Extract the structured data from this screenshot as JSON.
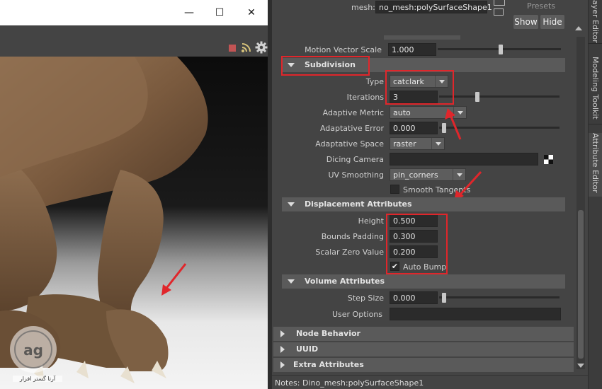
{
  "window": {
    "minimize_glyph": "—",
    "maximize_glyph": "☐",
    "close_glyph": "✕"
  },
  "render_toolbar": {
    "icons": [
      "stop-icon",
      "rss-icon",
      "gear-icon"
    ],
    "stop_color": "#c25454"
  },
  "attribute_editor": {
    "mesh_label": "mesh:",
    "mesh_value": "no_mesh:polySurfaceShape1",
    "presets_label": "Presets",
    "show_label": "Show",
    "hide_label": "Hide",
    "motion_vector_scale": {
      "label": "Motion Vector Scale",
      "value": "1.000",
      "slider": 0.53
    },
    "subdivision": {
      "title": "Subdivision",
      "type": {
        "label": "Type",
        "value": "catclark"
      },
      "iterations": {
        "label": "Iterations",
        "value": "3",
        "slider": 0.3
      },
      "adaptive_metric": {
        "label": "Adaptive Metric",
        "value": "auto"
      },
      "adaptive_error": {
        "label": "Adaptative Error",
        "value": "0.000",
        "slider": 0.0
      },
      "adaptive_space": {
        "label": "Adaptative Space",
        "value": "raster"
      },
      "dicing_camera": {
        "label": "Dicing Camera",
        "value": ""
      },
      "uv_smoothing": {
        "label": "UV Smoothing",
        "value": "pin_corners"
      },
      "smooth_tangents": {
        "label": "Smooth Tangents",
        "checked": false
      }
    },
    "displacement": {
      "title": "Displacement Attributes",
      "height": {
        "label": "Height",
        "value": "0.500"
      },
      "bounds_padding": {
        "label": "Bounds Padding",
        "value": "0.300"
      },
      "scalar_zero_value": {
        "label": "Scalar Zero Value",
        "value": "0.200"
      },
      "auto_bump": {
        "label": "Auto Bump",
        "checked": true,
        "check_glyph": "✔"
      }
    },
    "volume": {
      "title": "Volume Attributes",
      "step_size": {
        "label": "Step Size",
        "value": "0.000",
        "slider": 0.0
      },
      "user_options": {
        "label": "User Options",
        "value": ""
      }
    },
    "collapsed_sections": [
      "Node Behavior",
      "UUID",
      "Extra Attributes"
    ],
    "notes": "Notes:  Dino_mesh:polySurfaceShape1"
  },
  "side_tabs": [
    "Layer Editor",
    "Modeling Toolkit",
    "Attribute Editor"
  ],
  "side_tab_visible": [
    "ayer Editor",
    "Modeling Toolkit",
    "Attribute Editor"
  ],
  "watermark": {
    "caption": "آرتا گستر افزار"
  },
  "colors": {
    "highlight": "#e0262b",
    "panel": "#444444",
    "field": "#2b2b2b"
  }
}
